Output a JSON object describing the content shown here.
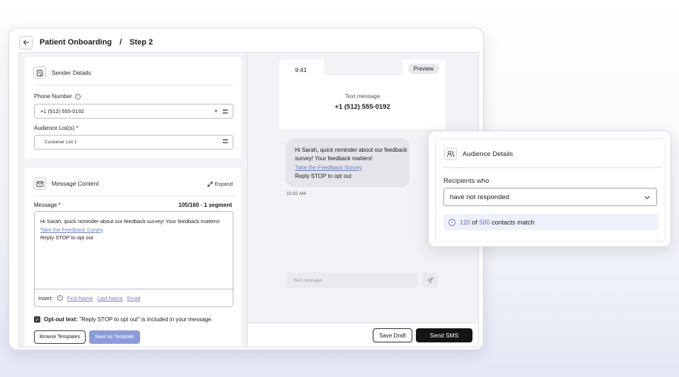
{
  "header": {
    "crumb_main": "Patient Onboarding",
    "crumb_sep": "/",
    "crumb_step": "Step 2"
  },
  "sender": {
    "title": "Sender Details",
    "phone_label": "Phone Number",
    "phone_value": "+1 (512) 555-0192",
    "audience_label": "Audience List(s) *",
    "audience_chip": "Customer List 1"
  },
  "message": {
    "title": "Message Content",
    "expand_label": "Expand",
    "label": "Message *",
    "count": "105/160 · 1 segment",
    "text_part1": "Hi Sarah, quick reminder about our feedback survey! Your feedback matters!",
    "link": "Take the Feedback Survey",
    "text_part2": "Reply STOP to opt out",
    "insert_label": "Insert:",
    "insert_tokens": [
      "First Name",
      "Last Name",
      "Email"
    ],
    "optout_bold": "Opt-out text:",
    "optout_rest": "\"Reply STOP to opt out\" is included in your message.",
    "browse_label": "Browse Templates",
    "save_template_label": "Save as Template"
  },
  "preview": {
    "time": "9:41",
    "pill": "Preview",
    "sub": "Text message",
    "number": "+1 (512) 555-0192",
    "bubble_part1": "Hi Sarah, quick reminder about our feedback survey! Your feedback matters!",
    "bubble_link": "Take the Feedback Survey",
    "bubble_part2": "Reply STOP to opt out",
    "msg_time": "10:32 AM",
    "compose_placeholder": "Text message"
  },
  "footer": {
    "save_draft": "Save Draft",
    "send_sms": "Send SMS"
  },
  "audience": {
    "title": "Audience Details",
    "recipients_label": "Recipients who",
    "select_value": "have not responded",
    "match_count": "120",
    "match_of": "of",
    "match_total": "500",
    "match_suffix": "contacts match"
  },
  "icons": {
    "back": "arrow-left-icon",
    "sender": "contact-card-icon",
    "message": "envelope-icon",
    "expand": "expand-arrows-icon",
    "send": "paper-plane-icon",
    "audience": "users-icon",
    "chevron": "chevron-down-icon",
    "info": "info-icon"
  },
  "colors": {
    "accent": "#8c9bd9",
    "link": "#6b7ec5",
    "primary_dark": "#141416"
  }
}
